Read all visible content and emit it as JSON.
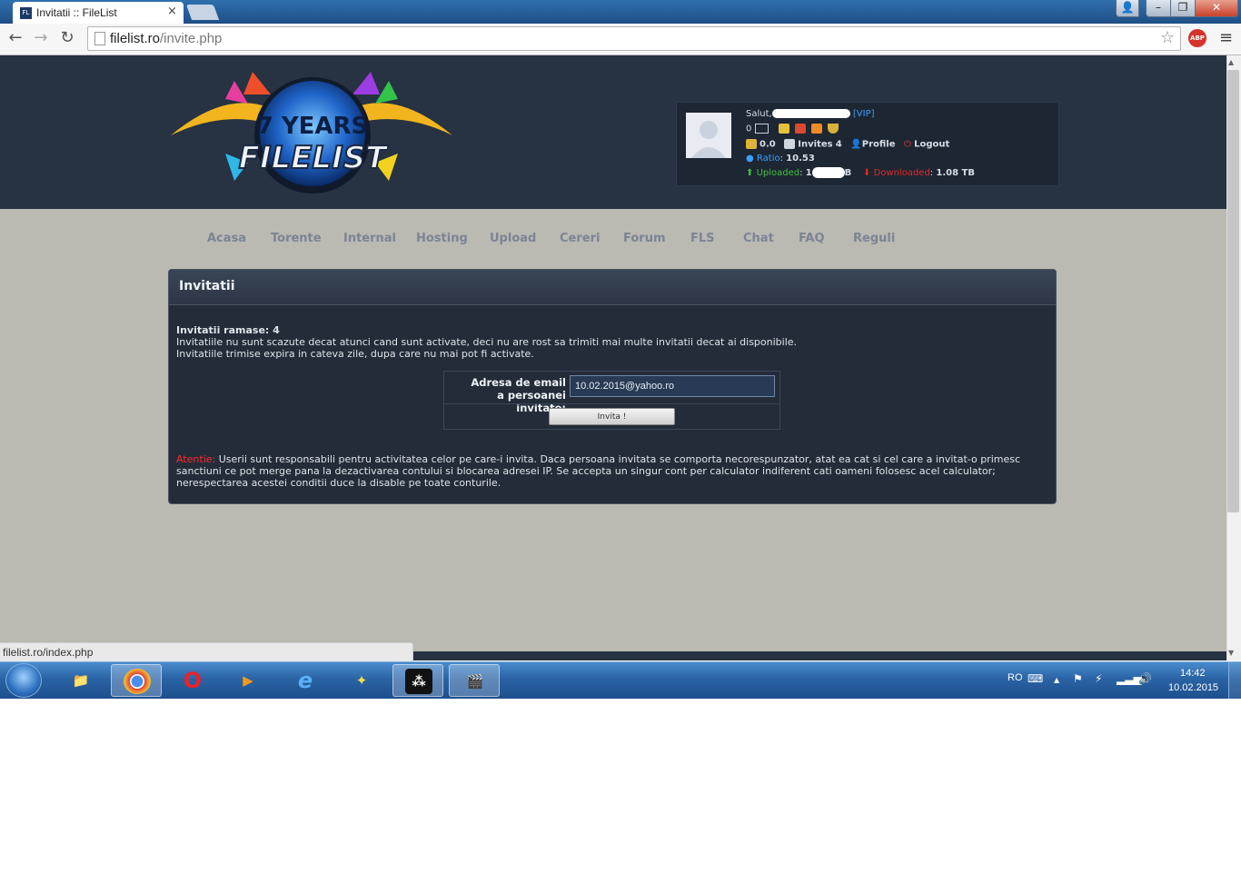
{
  "window": {
    "tab_title": "Invitatii :: FileList",
    "tab_favicon": "FL",
    "tab_close": "×",
    "user_btn": "👤",
    "min_btn": "–",
    "max_btn": "❐",
    "close_btn": "✕"
  },
  "toolbar": {
    "back": "←",
    "forward": "→",
    "reload": "↻",
    "url_host": "filelist.ro",
    "url_path": "/invite.php",
    "star": "☆",
    "abp": "ABP",
    "menu": "≡"
  },
  "logo": {
    "line1": "7 YEARS",
    "line2": "FILELIST"
  },
  "user": {
    "greeting": "Salut,",
    "rank": "[VIP]",
    "messages": "0",
    "bonus": "0.0",
    "invites_label": "Invites",
    "invites_count": "4",
    "profile": "Profile",
    "logout": "Logout",
    "ratio_label": "Ratio",
    "ratio_value": "10.53",
    "uploaded_label": "Uploaded",
    "uploaded_value": "1",
    "uploaded_suffix": "B",
    "downloaded_label": "Downloaded",
    "downloaded_value": "1.08 TB"
  },
  "nav": [
    "Acasa",
    "Torente",
    "Internal",
    "Hosting",
    "Upload",
    "Cereri",
    "Forum",
    "FLS",
    "Chat",
    "FAQ",
    "Reguli"
  ],
  "panel": {
    "title": "Invitatii",
    "remaining": "Invitatii ramase: 4",
    "line1": "Invitatiile nu sunt scazute decat atunci cand sunt activate, deci nu are rost sa trimiti mai multe invitatii decat ai disponibile.",
    "line2": "Invitatiile trimise expira in cateva zile, dupa care nu mai pot fi activate.",
    "form_label_1": "Adresa de email",
    "form_label_2": "a persoanei invitate:",
    "email_value": "10.02.2015@yahoo.ro",
    "button": "Invita !",
    "warning_label": "Atentie:",
    "warning_line1": " Userii sunt responsabili pentru activitatea celor pe care-i invita. Daca persoana invitata se comporta necorespunzator, atat ea cat si cel care a invitat-o primesc",
    "warning_line2": "sanctiuni ce pot merge pana la dezactivarea contului si blocarea adresei IP. Se accepta un singur cont per calculator indiferent cati oameni folosesc acel calculator;",
    "warning_line3": "nerespectarea acestei conditii duce la disable pe toate conturile."
  },
  "status": {
    "link": "filelist.ro/index.php"
  },
  "taskbar": {
    "lang": "RO",
    "time": "14:42",
    "date": "10.02.2015",
    "apps": [
      {
        "name": "explorer",
        "glyph": "📁"
      },
      {
        "name": "chrome",
        "glyph": "●"
      },
      {
        "name": "opera",
        "glyph": "O"
      },
      {
        "name": "media",
        "glyph": "▶"
      },
      {
        "name": "ie",
        "glyph": "e"
      },
      {
        "name": "app",
        "glyph": "✦"
      },
      {
        "name": "blackberry",
        "glyph": "⁂"
      },
      {
        "name": "movie",
        "glyph": "🎬"
      }
    ]
  },
  "colors": {
    "header_bg": "#273242",
    "page_bg": "#babab2",
    "panel_bg": "#242c39",
    "vip": "#3aa0ff",
    "uploaded": "#3fc43f",
    "downloaded": "#e02828",
    "warning": "#ff2a2a"
  }
}
